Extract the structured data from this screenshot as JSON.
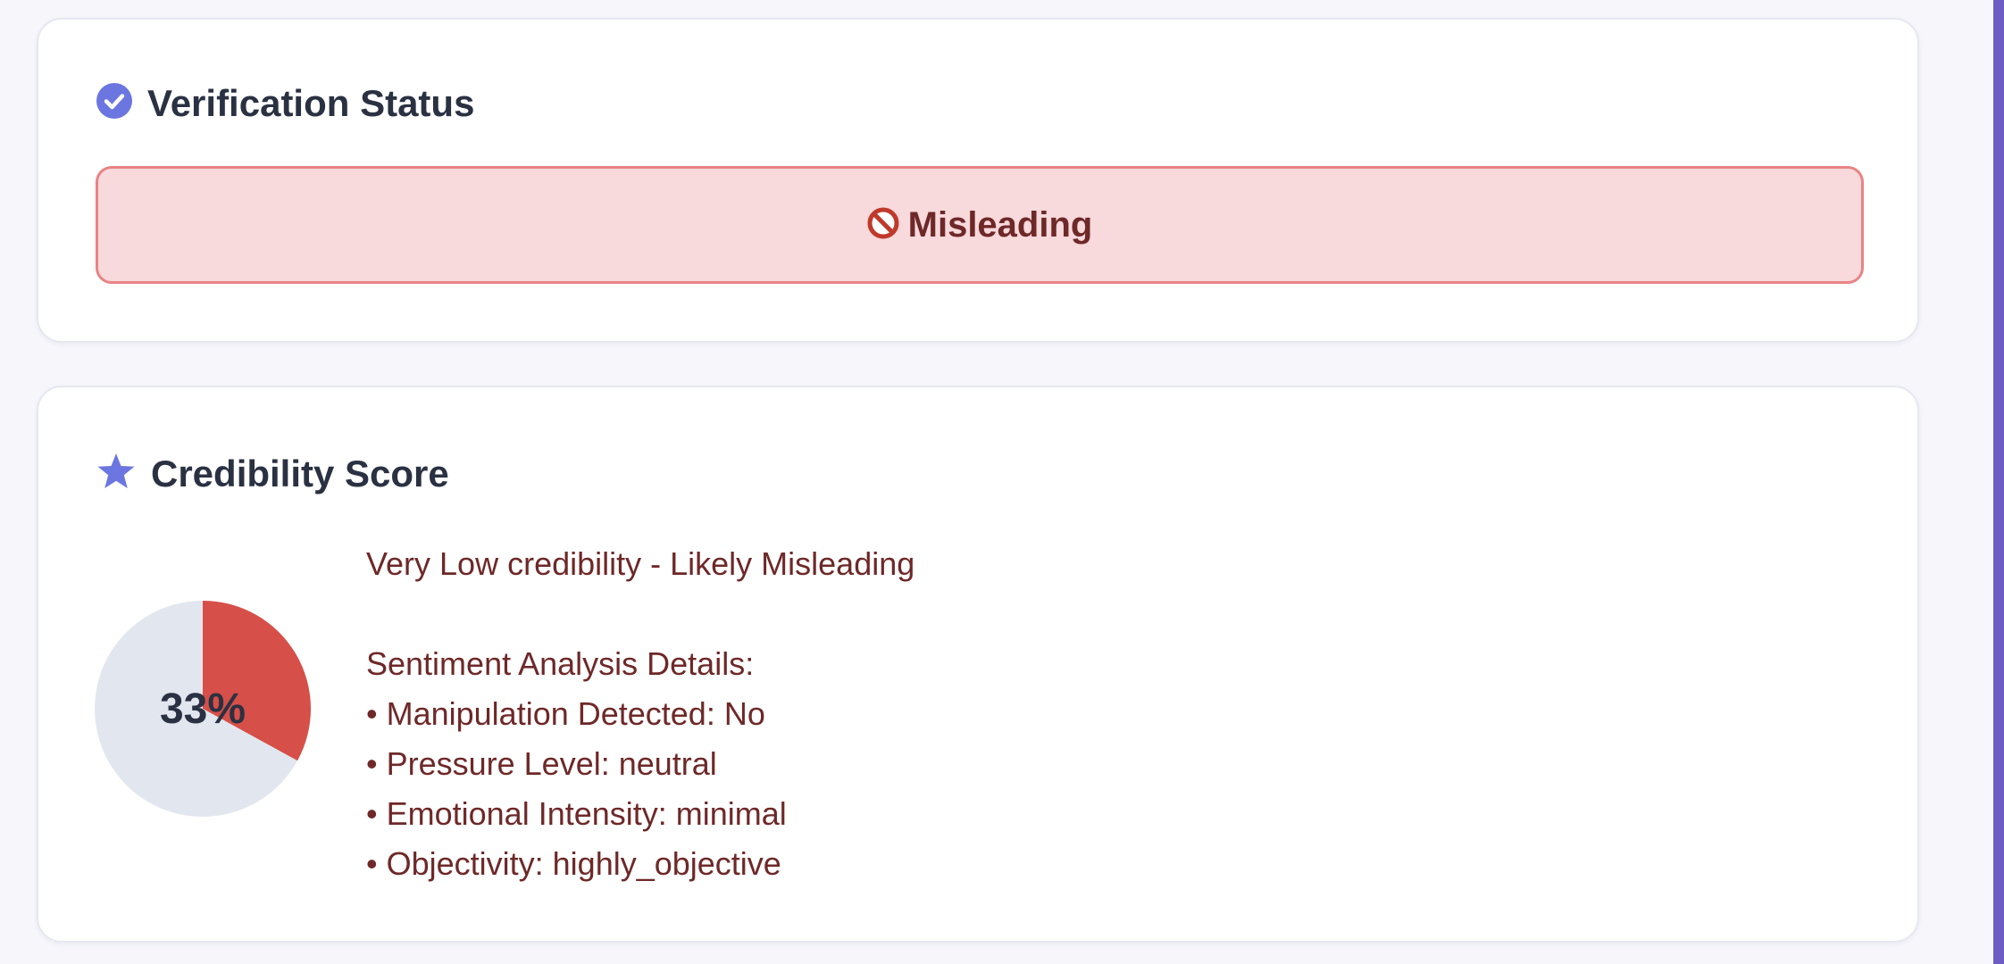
{
  "verification": {
    "title": "Verification Status",
    "title_icon": "check-circle-icon",
    "status_icon": "prohibited-icon",
    "status_label": "Misleading",
    "colors": {
      "status_bg": "#f8d9dc",
      "status_border": "#e98385",
      "status_text": "#6e2828"
    }
  },
  "credibility": {
    "title": "Credibility Score",
    "title_icon": "star-icon",
    "score_label": "33%",
    "summary": "Very Low credibility - Likely Misleading",
    "details_heading": "Sentiment Analysis Details:",
    "details": [
      "• Manipulation Detected: No",
      "• Pressure Level: neutral",
      "• Emotional Intensity: minimal",
      "• Objectivity: highly_objective"
    ]
  },
  "chart_data": {
    "type": "pie",
    "values": [
      33,
      67
    ],
    "categories": [
      "",
      ""
    ],
    "colors": [
      "#d64f48",
      "#e2e7ef"
    ]
  },
  "colors": {
    "accent": "#6b76e0",
    "title": "#2a3142",
    "scroll_accent": "#6c5cc4"
  }
}
